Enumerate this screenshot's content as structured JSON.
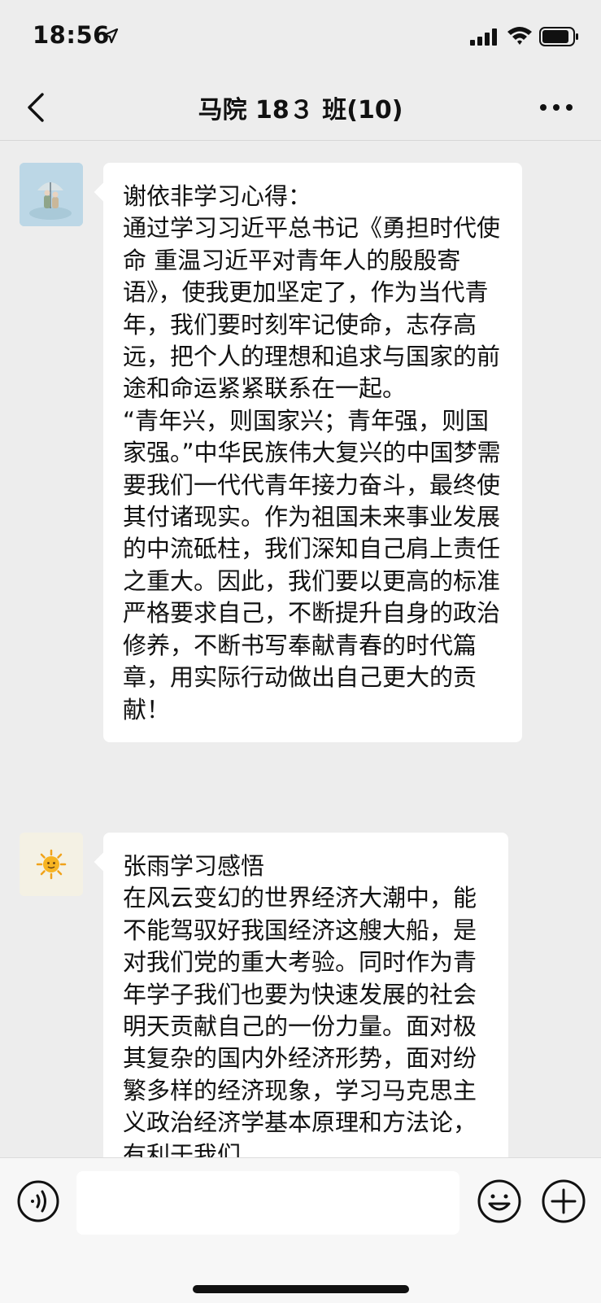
{
  "status_bar": {
    "time": "18:56",
    "icons": [
      "location-arrow-icon",
      "cellular-signal-icon",
      "wifi-icon",
      "battery-icon"
    ]
  },
  "header": {
    "title": "马院 18３ 班(10)",
    "back_icon": "chevron-left-icon",
    "more_icon": "more-dots-icon"
  },
  "messages": [
    {
      "avatar": "avatar-landscape",
      "text": "谢依非学习心得：\n通过学习习近平总书记《勇担时代使命 重温习近平对青年人的殷殷寄语》，使我更加坚定了，作为当代青年，我们要时刻牢记使命，志存高远，把个人的理想和追求与国家的前途和命运紧紧联系在一起。\n“青年兴，则国家兴；青年强，则国家强。”中华民族伟大复兴的中国梦需要我们一代代青年接力奋斗，最终使其付诸现实。作为祖国未来事业发展的中流砥柱，我们深知自己肩上责任之重大。因此，我们要以更高的标准严格要求自己，不断提升自身的政治修养，不断书写奉献青春的时代篇章，用实际行动做出自己更大的贡献！"
    },
    {
      "avatar": "avatar-sun",
      "text": "张雨学习感悟\n在风云变幻的世界经济大潮中，能不能驾驭好我国经济这艘大船，是对我们党的重大考验。同时作为青年学子我们也要为快速发展的社会明天贡献自己的一份力量。面对极其复杂的国内外经济形势，面对纷繁多样的经济现象，学习马克思主义政治经济学基本原理和方法论，有利于我们"
    }
  ],
  "input_bar": {
    "placeholder": "",
    "icons": [
      "voice-icon",
      "emoji-icon",
      "plus-icon"
    ]
  },
  "colors": {
    "background": "#ededed",
    "bubble": "#ffffff",
    "input_bar": "#f7f7f7"
  }
}
